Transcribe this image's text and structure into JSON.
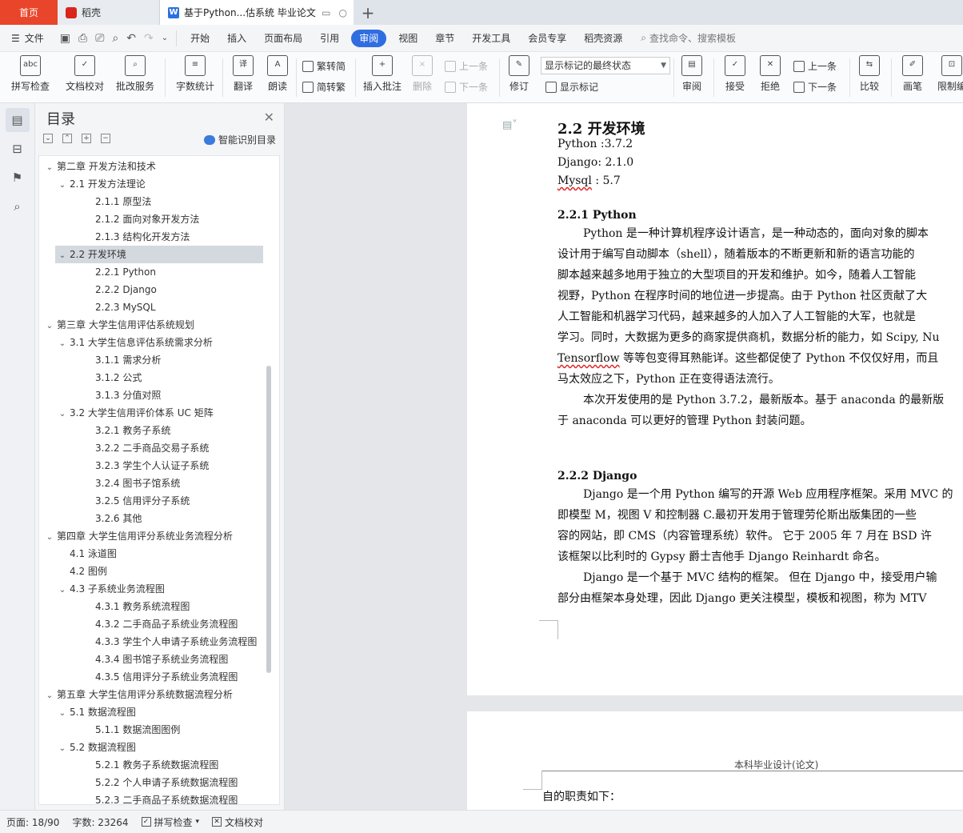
{
  "tabs": {
    "home": "首页",
    "docer": "稻壳",
    "doc": "基于Python...估系统 毕业论文",
    "plus": "+"
  },
  "menubar": {
    "file": "文件",
    "items": [
      "开始",
      "插入",
      "页面布局",
      "引用",
      "审阅",
      "视图",
      "章节",
      "开发工具",
      "会员专享",
      "稻壳资源"
    ],
    "active": "审阅",
    "search": "查找命令、搜索模板"
  },
  "ribbon": {
    "spell": "拼写检查",
    "proofread": "文档校对",
    "annotate_service": "批改服务",
    "word_count": "字数统计",
    "translate": "翻译",
    "read": "朗读",
    "to_trad": "繁转简",
    "to_simp": "简转繁",
    "insert_comment": "插入批注",
    "delete": "删除",
    "prev_comment": "上一条",
    "next_comment": "下一条",
    "revise": "修订",
    "markup_select": "显示标记的最终状态",
    "show_markup": "显示标记",
    "review": "审阅",
    "accept": "接受",
    "reject": "拒绝",
    "prev": "上一条",
    "next": "下一条",
    "compare": "比较",
    "pen": "画笔",
    "restrict": "限制编"
  },
  "toc": {
    "title": "目录",
    "smart": "智能识别目录",
    "items": [
      {
        "text": "第二章  开发方法和技术",
        "level": 1,
        "chev": "v"
      },
      {
        "text": "2.1 开发方法理论",
        "level": 2,
        "chev": "v"
      },
      {
        "text": "2.1.1 原型法",
        "level": 3,
        "chev": ""
      },
      {
        "text": "2.1.2 面向对象开发方法",
        "level": 3,
        "chev": ""
      },
      {
        "text": "2.1.3 结构化开发方法",
        "level": 3,
        "chev": ""
      },
      {
        "text": "2.2 开发环境",
        "level": 2,
        "chev": "v"
      },
      {
        "text": "2.2.1 Python",
        "level": 3,
        "chev": ""
      },
      {
        "text": "2.2.2 Django",
        "level": 3,
        "chev": ""
      },
      {
        "text": "2.2.3 MySQL",
        "level": 3,
        "chev": ""
      },
      {
        "text": "第三章  大学生信用评估系统规划",
        "level": 1,
        "chev": "v"
      },
      {
        "text": "3.1  大学生信息评估系统需求分析",
        "level": 2,
        "chev": "v"
      },
      {
        "text": "3.1.1 需求分析",
        "level": 3,
        "chev": ""
      },
      {
        "text": "3.1.2  公式",
        "level": 3,
        "chev": ""
      },
      {
        "text": "3.1.3  分值对照",
        "level": 3,
        "chev": ""
      },
      {
        "text": "3.2 大学生信用评价体系  UC 矩阵",
        "level": 2,
        "chev": "v"
      },
      {
        "text": "3.2.1 教务子系统",
        "level": 3,
        "chev": ""
      },
      {
        "text": "3.2.2 二手商品交易子系统",
        "level": 3,
        "chev": ""
      },
      {
        "text": "3.2.3 学生个人认证子系统",
        "level": 3,
        "chev": ""
      },
      {
        "text": "3.2.4 图书子馆系统",
        "level": 3,
        "chev": ""
      },
      {
        "text": "3.2.5 信用评分子系统",
        "level": 3,
        "chev": ""
      },
      {
        "text": "3.2.6 其他",
        "level": 3,
        "chev": ""
      },
      {
        "text": "第四章  大学生信用评分系统业务流程分析",
        "level": 1,
        "chev": "v"
      },
      {
        "text": "4.1 泳道图",
        "level": 2,
        "chev": ""
      },
      {
        "text": "4.2 图例",
        "level": 2,
        "chev": ""
      },
      {
        "text": "4.3 子系统业务流程图",
        "level": 2,
        "chev": "v"
      },
      {
        "text": "4.3.1 教务系统流程图",
        "level": 3,
        "chev": ""
      },
      {
        "text": "4.3.2 二手商品子系统业务流程图",
        "level": 3,
        "chev": ""
      },
      {
        "text": "4.3.3 学生个人申请子系统业务流程图",
        "level": 3,
        "chev": ""
      },
      {
        "text": "4.3.4 图书馆子系统业务流程图",
        "level": 3,
        "chev": ""
      },
      {
        "text": "4.3.5 信用评分子系统业务流程图",
        "level": 3,
        "chev": ""
      },
      {
        "text": "第五章  大学生信用评分系统数据流程分析",
        "level": 1,
        "chev": "v"
      },
      {
        "text": "5.1 数据流程图",
        "level": 2,
        "chev": "v"
      },
      {
        "text": "5.1.1 数据流图图例",
        "level": 3,
        "chev": ""
      },
      {
        "text": "5.2 数据流程图",
        "level": 2,
        "chev": "v"
      },
      {
        "text": "5.2.1 教务子系统数据流程图",
        "level": 3,
        "chev": ""
      },
      {
        "text": "5.2.2 个人申请子系统数据流程图",
        "level": 3,
        "chev": ""
      },
      {
        "text": "5.2.3 二手商品子系统数据流程图",
        "level": 3,
        "chev": ""
      }
    ],
    "selected": "2.2 开发环境"
  },
  "doc": {
    "h_22": "2.2 开发环境",
    "env_python": "Python :3.7.2",
    "env_django": "Django: 2.1.0",
    "env_mysql_a": "Mysql",
    "env_mysql_b": " : 5.7",
    "h_221": "2.2.1 Python",
    "py_lines": [
      "Python 是一种计算机程序设计语言，是一种动态的，面向对象的脚本",
      "设计用于编写自动脚本（shell），随着版本的不断更新和新的语言功能的",
      "脚本越来越多地用于独立的大型项目的开发和维护。如今，随着人工智能",
      "视野，Python 在程序时间的地位进一步提高。由于 Python 社区贡献了大",
      "人工智能和机器学习代码，越来越多的人加入了人工智能的大军，也就是",
      "学习。同时，大数据为更多的商家提供商机，数据分析的能力，如 Scipy, Nu",
      "Tensorflow 等等包变得耳熟能详。这些都促使了 Python 不仅仅好用，而且",
      "马太效应之下，Python 正在变得语法流行。",
      "本次开发使用的是 Python 3.7.2，最新版本。基于 anaconda 的最新版",
      "于 anaconda 可以更好的管理 Python 封装问题。"
    ],
    "h_222": "2.2.2 Django",
    "dj_lines": [
      "Django 是一个用 Python 编写的开源 Web 应用程序框架。采用 MVC 的",
      "即模型 M，视图 V 和控制器 C.最初开发用于管理劳伦斯出版集团的一些",
      "容的网站，即 CMS（内容管理系统）软件。  它于 2005 年 7 月在 BSD 许",
      "该框架以比利时的 Gypsy 爵士吉他手 Django Reinhardt 命名。",
      "Django 是一个基于 MVC 结构的框架。 但在 Django 中，接受用户输",
      "部分由框架本身处理，因此 Django 更关注模型，模板和视图，称为 MTV"
    ],
    "page2_header": "本科毕业设计(论文)",
    "page2_text": "自的职责如下："
  },
  "status": {
    "page": "页面: 18/90",
    "words": "字数: 23264",
    "spell": "拼写检查",
    "proof": "文档校对"
  }
}
